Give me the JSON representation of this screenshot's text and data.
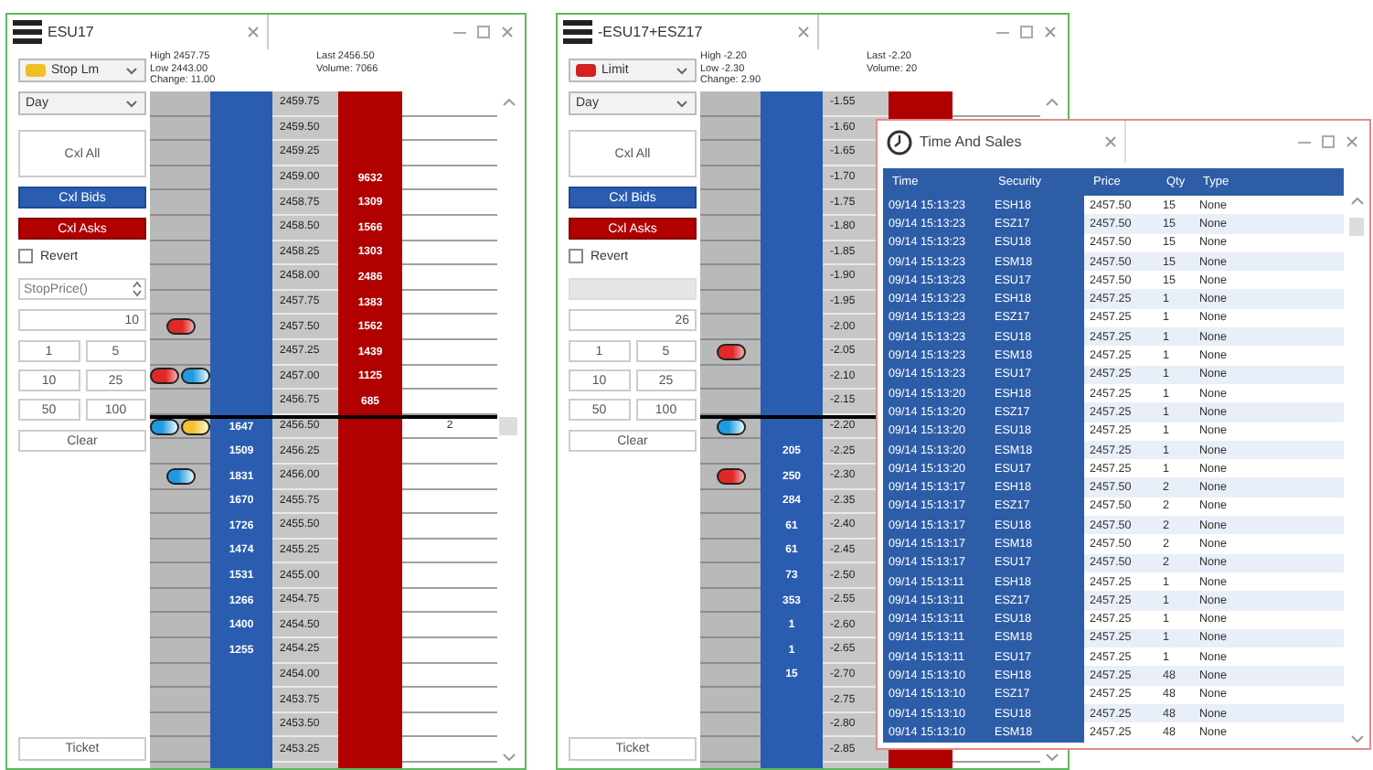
{
  "windows": [
    {
      "title": "ESU17",
      "stats": {
        "high": "High 2457.75",
        "low": "Low 2443.00",
        "change": "Change: 11.00",
        "last": "Last 2456.50",
        "volume": "Volume: 7066"
      },
      "order_type": {
        "label": "Stop Lm",
        "color": "#f0c020"
      },
      "tif": "Day",
      "cancel_buttons": [
        {
          "label": "Cxl All",
          "kind": "all"
        },
        {
          "label": "Cxl Bids",
          "kind": "bids"
        },
        {
          "label": "Cxl Asks",
          "kind": "asks"
        }
      ],
      "revert": {
        "label": "Revert",
        "checked": false
      },
      "stop_price": {
        "placeholder": "StopPrice()",
        "disabled": false
      },
      "quantity": "10",
      "sizes": [
        "1",
        "5",
        "10",
        "25",
        "50",
        "100"
      ],
      "clear": "Clear",
      "ticket": "Ticket",
      "rows": [
        {
          "price": "2459.75",
          "last": false
        },
        {
          "price": "2459.50",
          "last": false
        },
        {
          "price": "2459.25",
          "last": false
        },
        {
          "price": "2459.00",
          "ask": "9632",
          "last": false
        },
        {
          "price": "2458.75",
          "ask": "1309",
          "last": false
        },
        {
          "price": "2458.50",
          "ask": "1566",
          "last": false
        },
        {
          "price": "2458.25",
          "ask": "1303",
          "last": false
        },
        {
          "price": "2458.00",
          "ask": "2486",
          "last": false
        },
        {
          "price": "2457.75",
          "ask": "1383",
          "last": false
        },
        {
          "price": "2457.50",
          "ask": "1562",
          "orders": [
            {
              "kind": "sell"
            }
          ],
          "last": false
        },
        {
          "price": "2457.25",
          "ask": "1439",
          "last": false
        },
        {
          "price": "2457.00",
          "ask": "1125",
          "orders": [
            {
              "kind": "sell"
            },
            {
              "kind": "buy"
            }
          ],
          "last": false
        },
        {
          "price": "2456.75",
          "ask": "685",
          "last": false
        },
        {
          "price": "2456.50",
          "bid": "1647",
          "volume": "2",
          "orders": [
            {
              "kind": "buy"
            },
            {
              "kind": "stop"
            }
          ],
          "last": true
        },
        {
          "price": "2456.25",
          "bid": "1509",
          "last": false
        },
        {
          "price": "2456.00",
          "bid": "1831",
          "orders": [
            {
              "kind": "buy"
            }
          ],
          "last": false
        },
        {
          "price": "2455.75",
          "bid": "1670",
          "last": false
        },
        {
          "price": "2455.50",
          "bid": "1726",
          "last": false
        },
        {
          "price": "2455.25",
          "bid": "1474",
          "last": false
        },
        {
          "price": "2455.00",
          "bid": "1531",
          "last": false
        },
        {
          "price": "2454.75",
          "bid": "1266",
          "last": false
        },
        {
          "price": "2454.50",
          "bid": "1400",
          "last": false
        },
        {
          "price": "2454.25",
          "bid": "1255",
          "last": false
        },
        {
          "price": "2454.00",
          "last": false
        },
        {
          "price": "2453.75",
          "last": false
        },
        {
          "price": "2453.50",
          "last": false
        },
        {
          "price": "2453.25",
          "last": false
        }
      ]
    },
    {
      "title": "-ESU17+ESZ17",
      "stats": {
        "high": "High -2.20",
        "low": "Low -2.30",
        "change": "Change: 2.90",
        "last": "Last -2.20",
        "volume": "Volume: 20"
      },
      "order_type": {
        "label": "Limit",
        "color": "#d42020"
      },
      "tif": "Day",
      "cancel_buttons": [
        {
          "label": "Cxl All",
          "kind": "all"
        },
        {
          "label": "Cxl Bids",
          "kind": "bids"
        },
        {
          "label": "Cxl Asks",
          "kind": "asks"
        }
      ],
      "revert": {
        "label": "Revert",
        "checked": false
      },
      "stop_price": {
        "disabled": true
      },
      "quantity": "26",
      "sizes": [
        "1",
        "5",
        "10",
        "25",
        "50",
        "100"
      ],
      "clear": "Clear",
      "ticket": "Ticket",
      "rows": [
        {
          "price": "-1.55",
          "last": false
        },
        {
          "price": "-1.60",
          "last": false
        },
        {
          "price": "-1.65",
          "last": false
        },
        {
          "price": "-1.70",
          "last": false
        },
        {
          "price": "-1.75",
          "last": false
        },
        {
          "price": "-1.80",
          "last": false
        },
        {
          "price": "-1.85",
          "last": false
        },
        {
          "price": "-1.90",
          "last": false
        },
        {
          "price": "-1.95",
          "last": false
        },
        {
          "price": "-2.00",
          "last": false
        },
        {
          "price": "-2.05",
          "orders": [
            {
              "kind": "sell"
            }
          ],
          "last": false
        },
        {
          "price": "-2.10",
          "last": false
        },
        {
          "price": "-2.15",
          "last": false
        },
        {
          "price": "-2.20",
          "orders": [
            {
              "kind": "buy"
            }
          ],
          "last": true
        },
        {
          "price": "-2.25",
          "bid": "205",
          "last": false
        },
        {
          "price": "-2.30",
          "bid": "250",
          "orders": [
            {
              "kind": "sell"
            }
          ],
          "last": false
        },
        {
          "price": "-2.35",
          "bid": "284",
          "last": false
        },
        {
          "price": "-2.40",
          "bid": "61",
          "last": false
        },
        {
          "price": "-2.45",
          "bid": "61",
          "last": false
        },
        {
          "price": "-2.50",
          "bid": "73",
          "last": false
        },
        {
          "price": "-2.55",
          "bid": "353",
          "last": false
        },
        {
          "price": "-2.60",
          "bid": "1",
          "last": false
        },
        {
          "price": "-2.65",
          "bid": "1",
          "last": false
        },
        {
          "price": "-2.70",
          "bid": "15",
          "last": false
        },
        {
          "price": "-2.75",
          "last": false
        },
        {
          "price": "-2.80",
          "last": false
        },
        {
          "price": "-2.85",
          "last": false
        }
      ]
    }
  ],
  "time_and_sales": {
    "title": "Time And Sales",
    "columns": [
      "Time",
      "Security",
      "Price",
      "Qty",
      "Type"
    ],
    "rows": [
      [
        "09/14 15:13:23",
        "ESH18",
        "2457.50",
        "15",
        "None"
      ],
      [
        "09/14 15:13:23",
        "ESZ17",
        "2457.50",
        "15",
        "None"
      ],
      [
        "09/14 15:13:23",
        "ESU18",
        "2457.50",
        "15",
        "None"
      ],
      [
        "09/14 15:13:23",
        "ESM18",
        "2457.50",
        "15",
        "None"
      ],
      [
        "09/14 15:13:23",
        "ESU17",
        "2457.50",
        "15",
        "None"
      ],
      [
        "09/14 15:13:23",
        "ESH18",
        "2457.25",
        "1",
        "None"
      ],
      [
        "09/14 15:13:23",
        "ESZ17",
        "2457.25",
        "1",
        "None"
      ],
      [
        "09/14 15:13:23",
        "ESU18",
        "2457.25",
        "1",
        "None"
      ],
      [
        "09/14 15:13:23",
        "ESM18",
        "2457.25",
        "1",
        "None"
      ],
      [
        "09/14 15:13:23",
        "ESU17",
        "2457.25",
        "1",
        "None"
      ],
      [
        "09/14 15:13:20",
        "ESH18",
        "2457.25",
        "1",
        "None"
      ],
      [
        "09/14 15:13:20",
        "ESZ17",
        "2457.25",
        "1",
        "None"
      ],
      [
        "09/14 15:13:20",
        "ESU18",
        "2457.25",
        "1",
        "None"
      ],
      [
        "09/14 15:13:20",
        "ESM18",
        "2457.25",
        "1",
        "None"
      ],
      [
        "09/14 15:13:20",
        "ESU17",
        "2457.25",
        "1",
        "None"
      ],
      [
        "09/14 15:13:17",
        "ESH18",
        "2457.50",
        "2",
        "None"
      ],
      [
        "09/14 15:13:17",
        "ESZ17",
        "2457.50",
        "2",
        "None"
      ],
      [
        "09/14 15:13:17",
        "ESU18",
        "2457.50",
        "2",
        "None"
      ],
      [
        "09/14 15:13:17",
        "ESM18",
        "2457.50",
        "2",
        "None"
      ],
      [
        "09/14 15:13:17",
        "ESU17",
        "2457.50",
        "2",
        "None"
      ],
      [
        "09/14 15:13:11",
        "ESH18",
        "2457.25",
        "1",
        "None"
      ],
      [
        "09/14 15:13:11",
        "ESZ17",
        "2457.25",
        "1",
        "None"
      ],
      [
        "09/14 15:13:11",
        "ESU18",
        "2457.25",
        "1",
        "None"
      ],
      [
        "09/14 15:13:11",
        "ESM18",
        "2457.25",
        "1",
        "None"
      ],
      [
        "09/14 15:13:11",
        "ESU17",
        "2457.25",
        "1",
        "None"
      ],
      [
        "09/14 15:13:10",
        "ESH18",
        "2457.25",
        "48",
        "None"
      ],
      [
        "09/14 15:13:10",
        "ESZ17",
        "2457.25",
        "48",
        "None"
      ],
      [
        "09/14 15:13:10",
        "ESU18",
        "2457.25",
        "48",
        "None"
      ],
      [
        "09/14 15:13:10",
        "ESM18",
        "2457.25",
        "48",
        "None"
      ]
    ]
  }
}
